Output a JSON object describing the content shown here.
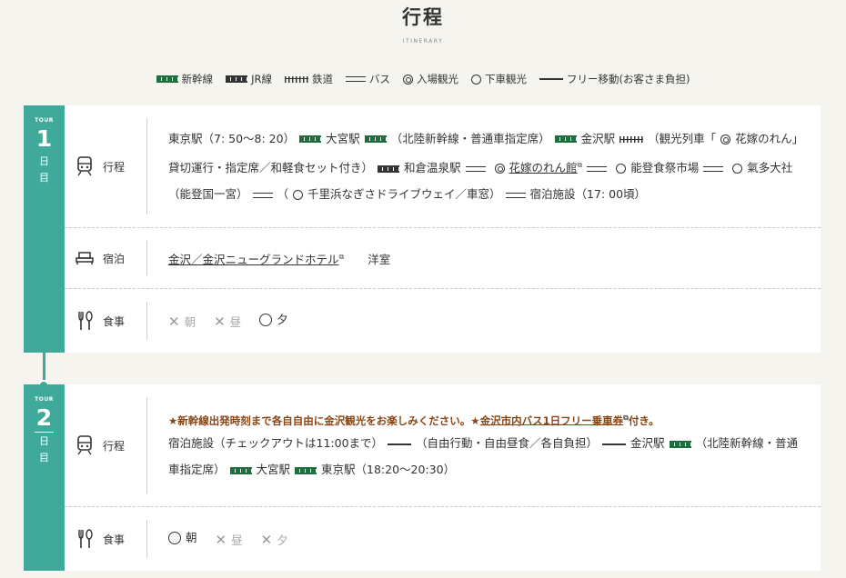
{
  "header": {
    "title": "行程",
    "subtitle": "ITINERARY"
  },
  "legend": [
    {
      "key": "shinkansen",
      "label": "新幹線"
    },
    {
      "key": "jr",
      "label": "JR線"
    },
    {
      "key": "rail",
      "label": "鉄道"
    },
    {
      "key": "bus",
      "label": "バス"
    },
    {
      "key": "entry",
      "label": "入場観光"
    },
    {
      "key": "drop",
      "label": "下車観光"
    },
    {
      "key": "free",
      "label": "フリー移動(お客さま負担)"
    }
  ],
  "days": [
    {
      "tour": "TOUR",
      "num": "1",
      "nichi": "日",
      "me": "目",
      "itinerary_label": "行程",
      "itinerary": [
        "東京駅（7: 50～8: 20）",
        "大宮駅",
        "（北陸新幹線・普通車指定席）",
        "金沢駅",
        "（観光列車「",
        "花嫁のれん」貸切運行・指定席／和軽食セット付き）",
        "和倉温泉駅",
        "花嫁のれん館",
        "能登食祭市場",
        "氣多大社（能登国一宮）",
        "（",
        "千里浜なぎさドライブウェイ／車窓）",
        "宿泊施設（17: 00頃）"
      ],
      "stay_label": "宿泊",
      "hotel": "金沢／金沢ニューグランドホテル",
      "room": "洋室",
      "meal_label": "食事",
      "meals": [
        {
          "label": "朝",
          "served": false
        },
        {
          "label": "昼",
          "served": false
        },
        {
          "label": "夕",
          "served": true
        }
      ]
    },
    {
      "tour": "TOUR",
      "num": "2",
      "nichi": "日",
      "me": "目",
      "itinerary_label": "行程",
      "notice_a": "★新幹線出発時刻まで各自自由に金沢観光をお楽しみください。★",
      "notice_link": "金沢市内バス1日フリー乗車券",
      "notice_b": "付き。",
      "itinerary": [
        "宿泊施設（チェックアウトは11:00まで）",
        "（自由行動・自由昼食／各自負担）",
        "金沢駅",
        "（北陸新幹線・普通車指定席）",
        "大宮駅",
        "東京駅（18:20～20:30）"
      ],
      "meal_label": "食事",
      "meals": [
        {
          "label": "朝",
          "served": true
        },
        {
          "label": "昼",
          "served": false
        },
        {
          "label": "夕",
          "served": false
        }
      ]
    }
  ],
  "colors": {
    "accent": "#3fa99a",
    "shinkansen": "#1f6e3d",
    "notice": "#8b4513"
  }
}
